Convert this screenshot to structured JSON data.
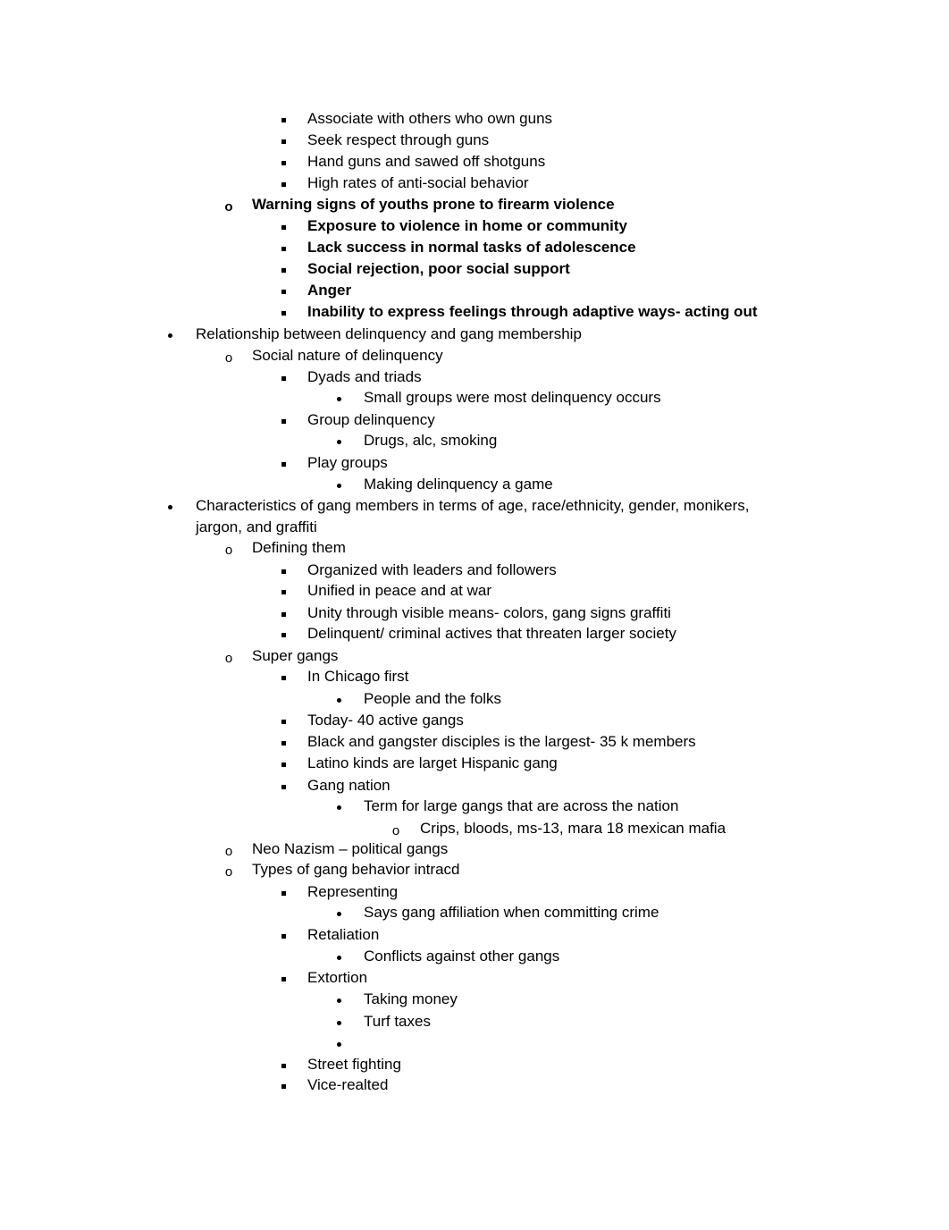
{
  "document": {
    "lines": [
      {
        "level": 3,
        "bullet": "square",
        "bold": false,
        "text": "Associate with others who own guns"
      },
      {
        "level": 3,
        "bullet": "square",
        "bold": false,
        "text": "Seek respect through guns"
      },
      {
        "level": 3,
        "bullet": "square",
        "bold": false,
        "text": "Hand guns and sawed off shotguns"
      },
      {
        "level": 3,
        "bullet": "square",
        "bold": false,
        "text": "High rates of anti-social behavior"
      },
      {
        "level": 2,
        "bullet": "o",
        "bold": true,
        "text": "Warning signs of youths prone to firearm violence"
      },
      {
        "level": 3,
        "bullet": "square",
        "bold": true,
        "text": "Exposure to violence in home or community"
      },
      {
        "level": 3,
        "bullet": "square",
        "bold": true,
        "text": "Lack success in normal tasks of adolescence"
      },
      {
        "level": 3,
        "bullet": "square",
        "bold": true,
        "text": "Social rejection, poor social support"
      },
      {
        "level": 3,
        "bullet": "square",
        "bold": true,
        "text": "Anger"
      },
      {
        "level": 3,
        "bullet": "square",
        "bold": true,
        "text": "Inability to express feelings through adaptive ways- acting out"
      },
      {
        "level": 1,
        "bullet": "dot",
        "bold": false,
        "text": "Relationship between delinquency and gang membership"
      },
      {
        "level": 2,
        "bullet": "o",
        "bold": false,
        "text": "Social nature of delinquency"
      },
      {
        "level": 3,
        "bullet": "square",
        "bold": false,
        "text": "Dyads and triads"
      },
      {
        "level": 4,
        "bullet": "dot",
        "bold": false,
        "text": "Small groups were most delinquency occurs"
      },
      {
        "level": 3,
        "bullet": "square",
        "bold": false,
        "text": "Group delinquency"
      },
      {
        "level": 4,
        "bullet": "dot",
        "bold": false,
        "text": "Drugs, alc, smoking"
      },
      {
        "level": 3,
        "bullet": "square",
        "bold": false,
        "text": "Play groups"
      },
      {
        "level": 4,
        "bullet": "dot",
        "bold": false,
        "text": "Making delinquency a game"
      },
      {
        "level": 1,
        "bullet": "dot",
        "bold": false,
        "text": "Characteristics of gang members in terms of age, race/ethnicity, gender, monikers,"
      },
      {
        "level": 1,
        "bullet": "none",
        "bold": false,
        "text": "jargon, and graffiti"
      },
      {
        "level": 2,
        "bullet": "o",
        "bold": false,
        "text": "Defining them"
      },
      {
        "level": 3,
        "bullet": "square",
        "bold": false,
        "text": "Organized with leaders and followers"
      },
      {
        "level": 3,
        "bullet": "square",
        "bold": false,
        "text": "Unified in peace and at war"
      },
      {
        "level": 3,
        "bullet": "square",
        "bold": false,
        "text": "Unity through visible means- colors, gang signs graffiti"
      },
      {
        "level": 3,
        "bullet": "square",
        "bold": false,
        "text": "Delinquent/ criminal actives that threaten larger society"
      },
      {
        "level": 2,
        "bullet": "o",
        "bold": false,
        "text": "Super gangs"
      },
      {
        "level": 3,
        "bullet": "square",
        "bold": false,
        "text": "In Chicago first"
      },
      {
        "level": 4,
        "bullet": "dot",
        "bold": false,
        "text": "People and the folks"
      },
      {
        "level": 3,
        "bullet": "square",
        "bold": false,
        "text": "Today- 40 active gangs"
      },
      {
        "level": 3,
        "bullet": "square",
        "bold": false,
        "text": "Black and gangster disciples is the largest- 35 k members"
      },
      {
        "level": 3,
        "bullet": "square",
        "bold": false,
        "text": "Latino kinds are larget Hispanic gang"
      },
      {
        "level": 3,
        "bullet": "square",
        "bold": false,
        "text": "Gang nation"
      },
      {
        "level": 4,
        "bullet": "dot",
        "bold": false,
        "text": "Term for large gangs that are across the nation"
      },
      {
        "level": 5,
        "bullet": "o",
        "bold": false,
        "text": "Crips, bloods, ms-13, mara 18 mexican mafia"
      },
      {
        "level": 2,
        "bullet": "o",
        "bold": false,
        "text": "Neo Nazism – political gangs"
      },
      {
        "level": 2,
        "bullet": "o",
        "bold": false,
        "text": "Types of gang behavior   intracd"
      },
      {
        "level": 3,
        "bullet": "square",
        "bold": false,
        "text": "Representing"
      },
      {
        "level": 4,
        "bullet": "dot",
        "bold": false,
        "text": "Says gang affiliation when committing crime"
      },
      {
        "level": 3,
        "bullet": "square",
        "bold": false,
        "text": "Retaliation"
      },
      {
        "level": 4,
        "bullet": "dot",
        "bold": false,
        "text": "Conflicts against other gangs"
      },
      {
        "level": 3,
        "bullet": "square",
        "bold": false,
        "text": "Extortion"
      },
      {
        "level": 4,
        "bullet": "dot",
        "bold": false,
        "text": "Taking money"
      },
      {
        "level": 4,
        "bullet": "dot",
        "bold": false,
        "text": "Turf taxes"
      },
      {
        "level": 4,
        "bullet": "dot",
        "bold": false,
        "text": ""
      },
      {
        "level": 3,
        "bullet": "square",
        "bold": false,
        "text": "Street fighting"
      },
      {
        "level": 3,
        "bullet": "square",
        "bold": false,
        "text": "Vice-realted"
      }
    ]
  }
}
